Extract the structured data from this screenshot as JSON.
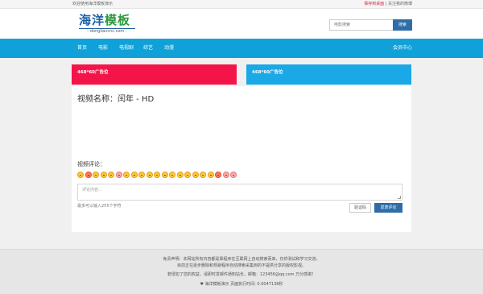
{
  "topbar": {
    "welcome": "欢迎使用海洋模板演示",
    "save_to_desktop": "保存到桌面",
    "separator": "|",
    "follow_weibo": "关注我的微博"
  },
  "header": {
    "logo_cn_part1": "海洋",
    "logo_cn_part2": "模板",
    "logo_en": "- dongliancnc.com -",
    "search_placeholder": "电影搜索",
    "search_button": "搜索"
  },
  "nav": {
    "items": [
      "首页",
      "电影",
      "电视剧",
      "综艺",
      "动漫"
    ],
    "member_center": "会员中心"
  },
  "ads": {
    "left": "468*60广告位",
    "right": "468*60广告位"
  },
  "video": {
    "title": "视频名称：闰年 - HD"
  },
  "comment": {
    "label": "视频评论：",
    "placeholder": "评论内容...",
    "limit_text": "最多可以输入255个字符",
    "verify_button": "验证码",
    "submit_button": "发表评论",
    "emoji_count": 21
  },
  "footer": {
    "line1": "免责声明：本网站所有内容都是靠程序在互联网上自动搜索而来，仅供测试和学习交流。",
    "line2": "目前正在逐步删除和规避程序自动搜索采集到的不提供分享的版权影视。",
    "line3": "若侵犯了您的权益，请即时发邮件通知站长，邮箱：123456@qq.com 万分感谢！",
    "line4": "♥ 海洋模板演示 页面执行时间: 0.0047138秒"
  },
  "colors": {
    "nav": "#10a1d8",
    "ad_left": "#f3154a",
    "ad_right": "#1aa8e6",
    "button": "#2d6da8"
  }
}
